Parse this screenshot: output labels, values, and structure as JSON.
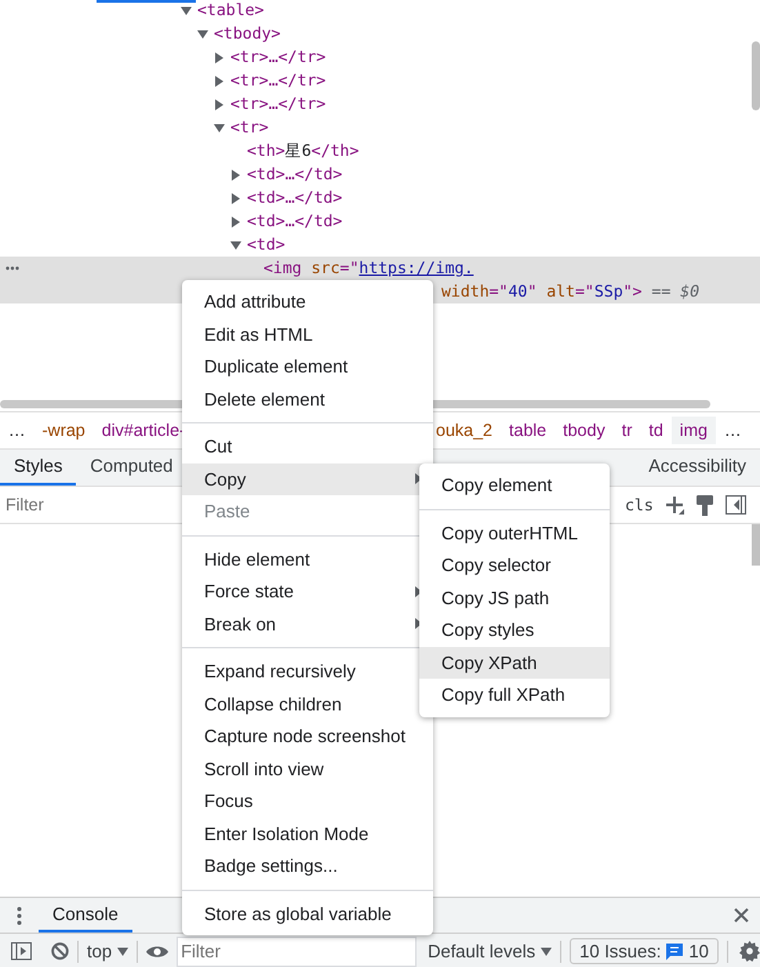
{
  "dom_tree": {
    "nodes": [
      {
        "parts": [
          {
            "kind": "tag",
            "text": "<table>"
          }
        ],
        "expanded": true,
        "children": [
          {
            "parts": [
              {
                "kind": "tag",
                "text": "<tbody>"
              }
            ],
            "expanded": true,
            "children": [
              {
                "parts": [
                  {
                    "kind": "tag",
                    "text": "<tr>…</tr>"
                  }
                ],
                "expanded": false
              },
              {
                "parts": [
                  {
                    "kind": "tag",
                    "text": "<tr>…</tr>"
                  }
                ],
                "expanded": false
              },
              {
                "parts": [
                  {
                    "kind": "tag",
                    "text": "<tr>…</tr>"
                  }
                ],
                "expanded": false
              },
              {
                "parts": [
                  {
                    "kind": "tag",
                    "text": "<tr>"
                  }
                ],
                "expanded": true,
                "children": [
                  {
                    "parts": [
                      {
                        "kind": "tag",
                        "text": "<th>"
                      },
                      {
                        "kind": "text",
                        "text": "星6"
                      },
                      {
                        "kind": "tag",
                        "text": "</th>"
                      }
                    ]
                  },
                  {
                    "parts": [
                      {
                        "kind": "tag",
                        "text": "<td>…</td>"
                      }
                    ],
                    "expanded": false
                  },
                  {
                    "parts": [
                      {
                        "kind": "tag",
                        "text": "<td>…</td>"
                      }
                    ],
                    "expanded": false
                  },
                  {
                    "parts": [
                      {
                        "kind": "tag",
                        "text": "<td>…</td>"
                      }
                    ],
                    "expanded": false
                  },
                  {
                    "parts": [
                      {
                        "kind": "tag",
                        "text": "<td>"
                      }
                    ],
                    "expanded": true,
                    "children": [
                      {
                        "selected": true,
                        "parts": [
                          {
                            "kind": "tag",
                            "text": "<img "
                          },
                          {
                            "kind": "attr",
                            "text": "src"
                          },
                          {
                            "kind": "tag",
                            "text": "=\""
                          },
                          {
                            "kind": "link",
                            "text": "https://img."
                          }
                        ],
                        "continuation": [
                          {
                            "kind": "attr",
                            "text": "width"
                          },
                          {
                            "kind": "tag",
                            "text": "=\""
                          },
                          {
                            "kind": "value",
                            "text": "40"
                          },
                          {
                            "kind": "tag",
                            "text": "\" "
                          },
                          {
                            "kind": "attr",
                            "text": "alt"
                          },
                          {
                            "kind": "tag",
                            "text": "=\""
                          },
                          {
                            "kind": "value",
                            "text": "SSp"
                          },
                          {
                            "kind": "tag",
                            "text": "\">"
                          },
                          {
                            "kind": "marker",
                            "text": " == $0"
                          }
                        ]
                      }
                    ]
                  }
                ]
              }
            ]
          }
        ]
      }
    ]
  },
  "breadcrumbs": [
    {
      "text": "…",
      "kind": "more",
      "selected": false
    },
    {
      "text": "-wrap",
      "kind": "class",
      "selected": false
    },
    {
      "text": "div#article-",
      "kind": "tag",
      "selected": false
    },
    {
      "text": "ouka_2",
      "kind": "class",
      "selected": false
    },
    {
      "text": "table",
      "kind": "tag",
      "selected": false
    },
    {
      "text": "tbody",
      "kind": "tag",
      "selected": false
    },
    {
      "text": "tr",
      "kind": "tag",
      "selected": false
    },
    {
      "text": "td",
      "kind": "tag",
      "selected": false
    },
    {
      "text": "img",
      "kind": "tag",
      "selected": true
    },
    {
      "text": "…",
      "kind": "more",
      "selected": false
    }
  ],
  "sidebar_tabs": [
    {
      "label": "Styles",
      "selected": true
    },
    {
      "label": "Computed",
      "selected": false
    },
    {
      "label": "Accessibility",
      "selected": false
    }
  ],
  "styles_filter": {
    "placeholder": "Filter",
    "cls_label": "cls"
  },
  "context_menu": [
    {
      "kind": "item",
      "label": "Add attribute",
      "disabled": false,
      "submenu": false,
      "highlighted": false
    },
    {
      "kind": "item",
      "label": "Edit as HTML",
      "disabled": false,
      "submenu": false,
      "highlighted": false
    },
    {
      "kind": "item",
      "label": "Duplicate element",
      "disabled": false,
      "submenu": false,
      "highlighted": false
    },
    {
      "kind": "item",
      "label": "Delete element",
      "disabled": false,
      "submenu": false,
      "highlighted": false
    },
    {
      "kind": "separator"
    },
    {
      "kind": "item",
      "label": "Cut",
      "disabled": false,
      "submenu": false,
      "highlighted": false
    },
    {
      "kind": "item",
      "label": "Copy",
      "disabled": false,
      "submenu": true,
      "highlighted": true
    },
    {
      "kind": "item",
      "label": "Paste",
      "disabled": true,
      "submenu": false,
      "highlighted": false
    },
    {
      "kind": "separator"
    },
    {
      "kind": "item",
      "label": "Hide element",
      "disabled": false,
      "submenu": false,
      "highlighted": false
    },
    {
      "kind": "item",
      "label": "Force state",
      "disabled": false,
      "submenu": true,
      "highlighted": false
    },
    {
      "kind": "item",
      "label": "Break on",
      "disabled": false,
      "submenu": true,
      "highlighted": false
    },
    {
      "kind": "separator"
    },
    {
      "kind": "item",
      "label": "Expand recursively",
      "disabled": false,
      "submenu": false,
      "highlighted": false
    },
    {
      "kind": "item",
      "label": "Collapse children",
      "disabled": false,
      "submenu": false,
      "highlighted": false
    },
    {
      "kind": "item",
      "label": "Capture node screenshot",
      "disabled": false,
      "submenu": false,
      "highlighted": false
    },
    {
      "kind": "item",
      "label": "Scroll into view",
      "disabled": false,
      "submenu": false,
      "highlighted": false
    },
    {
      "kind": "item",
      "label": "Focus",
      "disabled": false,
      "submenu": false,
      "highlighted": false
    },
    {
      "kind": "item",
      "label": "Enter Isolation Mode",
      "disabled": false,
      "submenu": false,
      "highlighted": false
    },
    {
      "kind": "item",
      "label": "Badge settings...",
      "disabled": false,
      "submenu": false,
      "highlighted": false
    },
    {
      "kind": "separator"
    },
    {
      "kind": "item",
      "label": "Store as global variable",
      "disabled": false,
      "submenu": false,
      "highlighted": false
    }
  ],
  "copy_submenu": [
    {
      "kind": "item",
      "label": "Copy element",
      "highlighted": false
    },
    {
      "kind": "separator"
    },
    {
      "kind": "item",
      "label": "Copy outerHTML",
      "highlighted": false
    },
    {
      "kind": "item",
      "label": "Copy selector",
      "highlighted": false
    },
    {
      "kind": "item",
      "label": "Copy JS path",
      "highlighted": false
    },
    {
      "kind": "item",
      "label": "Copy styles",
      "highlighted": false
    },
    {
      "kind": "item",
      "label": "Copy XPath",
      "highlighted": true
    },
    {
      "kind": "item",
      "label": "Copy full XPath",
      "highlighted": false
    }
  ],
  "drawer": {
    "tabs": [
      {
        "label": "Console",
        "selected": true
      }
    ],
    "context": "top",
    "filter_placeholder": "Filter",
    "levels": "Default levels",
    "issues_label": "10 Issues:",
    "issues_count": "10"
  }
}
